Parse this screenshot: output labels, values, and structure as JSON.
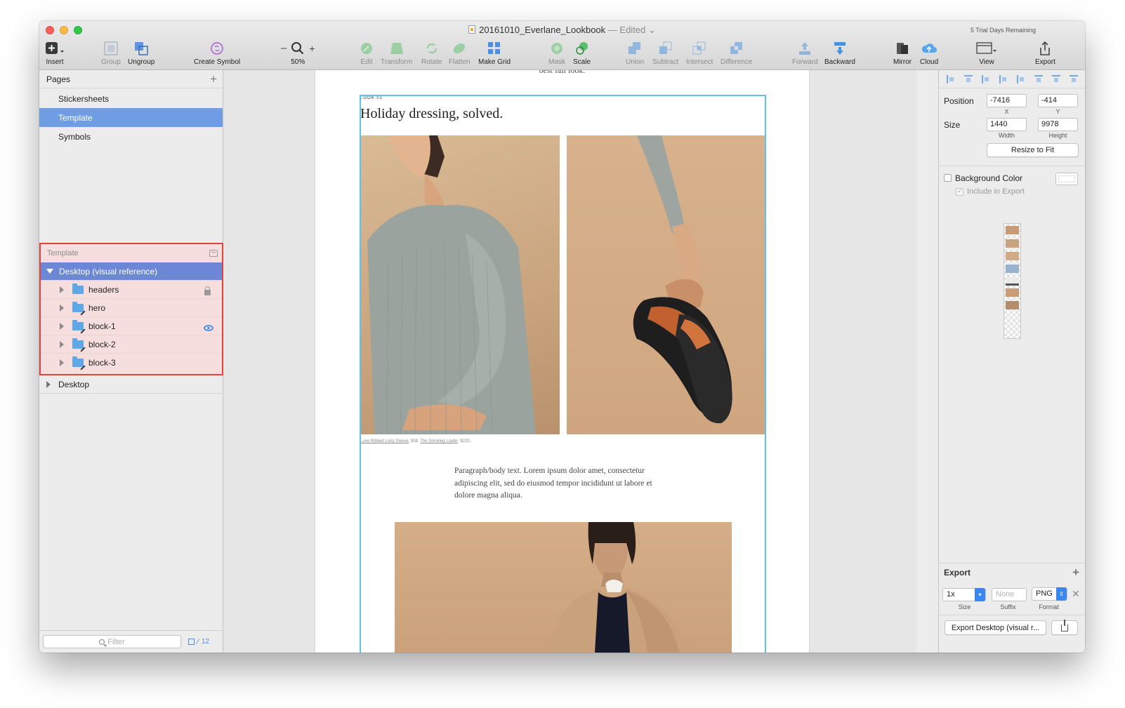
{
  "window": {
    "title": "20161010_Everlane_Lookbook",
    "title_status": "— Edited",
    "trial_notice": "5 Trial Days Remaining"
  },
  "toolbar": {
    "insert": "Insert",
    "group": "Group",
    "ungroup": "Ungroup",
    "create_symbol": "Create Symbol",
    "zoom_minus": "–",
    "zoom_plus": "+",
    "zoom_level": "50%",
    "edit": "Edit",
    "transform": "Transform",
    "rotate": "Rotate",
    "flatten": "Flatten",
    "make_grid": "Make Grid",
    "mask": "Mask",
    "scale": "Scale",
    "union": "Union",
    "subtract": "Subtract",
    "intersect": "Intersect",
    "difference": "Difference",
    "forward": "Forward",
    "backward": "Backward",
    "mirror": "Mirror",
    "cloud": "Cloud",
    "view": "View",
    "export": "Export"
  },
  "pages": {
    "header": "Pages",
    "items": [
      {
        "label": "Stickersheets"
      },
      {
        "label": "Template"
      },
      {
        "label": "Symbols"
      }
    ]
  },
  "layers": {
    "page_name": "Template",
    "artboard": "Desktop (visual reference)",
    "groups": [
      {
        "label": "headers"
      },
      {
        "label": "hero"
      },
      {
        "label": "block-1"
      },
      {
        "label": "block-2"
      },
      {
        "label": "block-3"
      }
    ],
    "second_artboard": "Desktop",
    "filter_placeholder": "Filter",
    "filter_count": "12"
  },
  "canvas": {
    "top_cut_text": "best fall look.",
    "look_label": "LOOK 01",
    "headline": "Holiday dressing, solved.",
    "caption_link1": "Luxe Ribbed Long Sleeve",
    "caption_price1": ", $58. ",
    "caption_link2": "The Smoking Loafer",
    "caption_price2": ", $220.",
    "paragraph": "Paragraph/body text. Lorem ipsum dolor amet, consectetur adipiscing elit, sed do eiusmod tempor incididunt ut labore et dolore magna aliqua."
  },
  "inspector": {
    "position_label": "Position",
    "x_value": "-7416",
    "x_label": "X",
    "y_value": "-414",
    "y_label": "Y",
    "size_label": "Size",
    "width_value": "1440",
    "width_label": "Width",
    "height_value": "9978",
    "height_label": "Height",
    "resize_button": "Resize to Fit",
    "background_color": "Background Color",
    "include_in_export": "Include in Export"
  },
  "export": {
    "header": "Export",
    "size_value": "1x",
    "suffix_placeholder": "None",
    "format_value": "PNG",
    "size_label": "Size",
    "suffix_label": "Suffix",
    "format_label": "Format",
    "export_button": "Export Desktop (visual r..."
  },
  "colors": {
    "selection_blue": "#6f9de3",
    "layer_highlight": "#e0443c",
    "artboard_outline": "#5ec3ea",
    "accent": "#3b87f0"
  }
}
